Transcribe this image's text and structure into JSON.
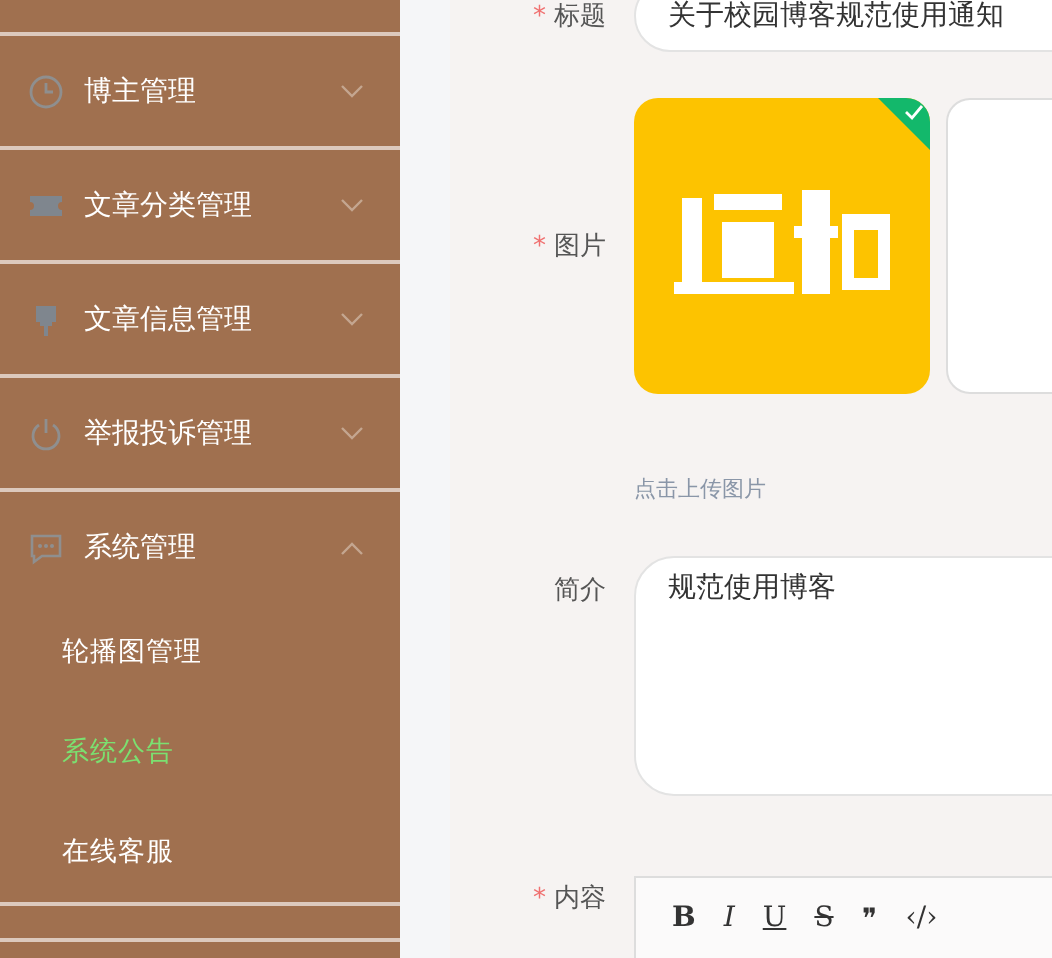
{
  "sidebar": {
    "items": [
      {
        "label": "博主管理",
        "expanded": false
      },
      {
        "label": "文章分类管理",
        "expanded": false
      },
      {
        "label": "文章信息管理",
        "expanded": false
      },
      {
        "label": "举报投诉管理",
        "expanded": false
      },
      {
        "label": "系统管理",
        "expanded": true,
        "children": [
          {
            "label": "轮播图管理",
            "selected": false
          },
          {
            "label": "系统公告",
            "selected": true
          },
          {
            "label": "在线客服",
            "selected": false
          }
        ]
      }
    ]
  },
  "form": {
    "fields": [
      {
        "kind": "text",
        "label": "标题",
        "required_mark": "*",
        "value": "关于校园博客规范使用通知"
      },
      {
        "label": "图片",
        "required_mark": "*",
        "uploaded": true,
        "hint": "点击上传图片"
      },
      {
        "kind": "textarea",
        "label": "简介",
        "value": "规范使用博客"
      },
      {
        "kind": "editor",
        "label": "内容",
        "required_mark": "*",
        "toolbar": [
          "B",
          "I",
          "U",
          "S",
          "❞",
          "‹/›"
        ]
      }
    ]
  }
}
